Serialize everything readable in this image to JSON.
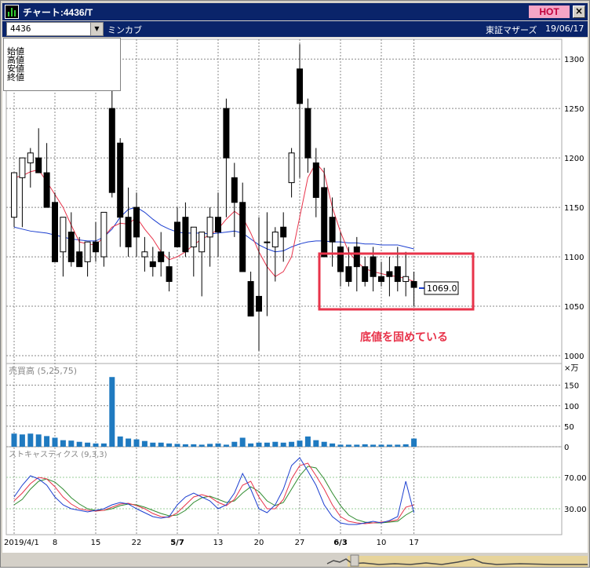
{
  "window": {
    "title": "チャート:4436/T",
    "hot_label": "HOT",
    "close_label": "×"
  },
  "toolbar": {
    "code": "4436",
    "company": "ミンカブ",
    "market": "東証マザーズ",
    "date": "19/06/17"
  },
  "ohlc_labels": [
    "始値",
    "高値",
    "安値",
    "終値"
  ],
  "price_axis": {
    "ticks": [
      "1300",
      "1250",
      "1200",
      "1150",
      "1100",
      "1050",
      "1000"
    ],
    "last_price": "1069.0"
  },
  "volume_panel": {
    "label": "売買高 (5,25,75)",
    "unit": "×万",
    "ticks": [
      "150",
      "100",
      "50",
      "0"
    ]
  },
  "stochastics_panel": {
    "label": "ストキャスティクス (9,3,3)",
    "ticks": [
      "70.00",
      "30.00"
    ]
  },
  "x_axis": {
    "labels": [
      "2019/4/1",
      "8",
      "15",
      "22",
      "5/7",
      "13",
      "20",
      "27",
      "6/3",
      "10",
      "17"
    ],
    "bold_labels": [
      "5/7",
      "6/3"
    ]
  },
  "annotation": {
    "text": "底値を固めている",
    "color": "#e8334a"
  },
  "colors": {
    "ma_short": "#e8334a",
    "ma_long": "#1c3fd0",
    "volume": "#1f7ac0",
    "stoch_k": "#1c3fd0",
    "stoch_d": "#e8334a",
    "stoch_slow": "#2e8b2e"
  },
  "chart_data": {
    "type": "candlestick",
    "dates": [
      "4/1",
      "4/2",
      "4/3",
      "4/4",
      "4/5",
      "4/8",
      "4/9",
      "4/10",
      "4/11",
      "4/12",
      "4/15",
      "4/16",
      "4/17",
      "4/18",
      "4/19",
      "4/22",
      "4/23",
      "4/24",
      "4/25",
      "4/26",
      "5/7",
      "5/8",
      "5/9",
      "5/10",
      "5/13",
      "5/14",
      "5/15",
      "5/16",
      "5/17",
      "5/20",
      "5/21",
      "5/22",
      "5/23",
      "5/24",
      "5/27",
      "5/28",
      "5/29",
      "5/30",
      "5/31",
      "6/3",
      "6/4",
      "6/5",
      "6/6",
      "6/7",
      "6/10",
      "6/11",
      "6/12",
      "6/13",
      "6/14",
      "6/17"
    ],
    "open": [
      1140,
      1180,
      1195,
      1200,
      1185,
      1155,
      1105,
      1125,
      1105,
      1095,
      1115,
      1100,
      1250,
      1215,
      1140,
      1150,
      1100,
      1095,
      1105,
      1090,
      1135,
      1140,
      1110,
      1105,
      1120,
      1140,
      1250,
      1180,
      1155,
      1075,
      1060,
      1115,
      1110,
      1130,
      1175,
      1290,
      1250,
      1195,
      1170,
      1140,
      1110,
      1090,
      1110,
      1090,
      1100,
      1080,
      1085,
      1090,
      1075,
      1075
    ],
    "high": [
      1160,
      1190,
      1210,
      1230,
      1215,
      1165,
      1140,
      1145,
      1120,
      1115,
      1135,
      1130,
      1325,
      1220,
      1170,
      1165,
      1120,
      1110,
      1125,
      1105,
      1150,
      1155,
      1130,
      1125,
      1150,
      1165,
      1260,
      1195,
      1175,
      1085,
      1140,
      1145,
      1130,
      1145,
      1210,
      1315,
      1260,
      1210,
      1190,
      1160,
      1125,
      1110,
      1120,
      1100,
      1110,
      1095,
      1100,
      1110,
      1105,
      1085
    ],
    "low": [
      1130,
      1130,
      1170,
      1185,
      1150,
      1095,
      1080,
      1090,
      1090,
      1080,
      1095,
      1090,
      1160,
      1110,
      1100,
      1100,
      1085,
      1080,
      1080,
      1065,
      1115,
      1100,
      1080,
      1060,
      1090,
      1100,
      1140,
      1120,
      1085,
      1040,
      1005,
      1040,
      1075,
      1095,
      1160,
      1180,
      1185,
      1140,
      1135,
      1090,
      1070,
      1070,
      1065,
      1070,
      1065,
      1070,
      1060,
      1065,
      1060,
      1050
    ],
    "close": [
      1185,
      1200,
      1205,
      1185,
      1150,
      1095,
      1140,
      1095,
      1090,
      1115,
      1105,
      1145,
      1165,
      1140,
      1110,
      1120,
      1105,
      1090,
      1095,
      1075,
      1110,
      1105,
      1130,
      1125,
      1140,
      1125,
      1200,
      1155,
      1085,
      1040,
      1045,
      1115,
      1125,
      1120,
      1205,
      1255,
      1200,
      1160,
      1100,
      1115,
      1085,
      1075,
      1090,
      1075,
      1080,
      1075,
      1080,
      1075,
      1080,
      1069
    ],
    "volume": [
      32,
      30,
      32,
      30,
      26,
      22,
      16,
      15,
      12,
      10,
      8,
      8,
      170,
      25,
      20,
      18,
      14,
      10,
      10,
      8,
      7,
      6,
      6,
      5,
      7,
      8,
      5,
      12,
      22,
      8,
      10,
      10,
      12,
      10,
      12,
      15,
      25,
      16,
      12,
      8,
      5,
      5,
      5,
      6,
      5,
      5,
      5,
      5,
      6,
      20
    ],
    "ma5": [
      1180,
      1182,
      1186,
      1188,
      1176,
      1163,
      1150,
      1132,
      1115,
      1113,
      1112,
      1120,
      1130,
      1134,
      1133,
      1140,
      1128,
      1118,
      1105,
      1097,
      1100,
      1105,
      1112,
      1118,
      1122,
      1128,
      1138,
      1146,
      1140,
      1124,
      1105,
      1090,
      1080,
      1085,
      1100,
      1140,
      1180,
      1195,
      1185,
      1150,
      1125,
      1105,
      1095,
      1088,
      1085,
      1083,
      1081,
      1080,
      1078,
      1075
    ],
    "ma25": [
      1130,
      1128,
      1126,
      1125,
      1124,
      1122,
      1120,
      1118,
      1117,
      1116,
      1116,
      1120,
      1128,
      1140,
      1148,
      1150,
      1145,
      1138,
      1132,
      1128,
      1125,
      1124,
      1124,
      1124,
      1123,
      1124,
      1125,
      1126,
      1124,
      1118,
      1112,
      1108,
      1105,
      1106,
      1110,
      1113,
      1115,
      1116,
      1116,
      1115,
      1115,
      1114,
      1114,
      1113,
      1113,
      1112,
      1112,
      1112,
      1110,
      1108
    ],
    "stoch_k": [
      45,
      60,
      72,
      68,
      60,
      45,
      35,
      30,
      28,
      26,
      28,
      30,
      35,
      38,
      36,
      30,
      25,
      20,
      18,
      20,
      35,
      45,
      50,
      45,
      40,
      30,
      35,
      50,
      75,
      55,
      30,
      25,
      35,
      55,
      85,
      95,
      78,
      60,
      35,
      20,
      12,
      10,
      10,
      12,
      14,
      12,
      15,
      20,
      65,
      25
    ],
    "stoch_d": [
      40,
      50,
      62,
      70,
      68,
      58,
      45,
      36,
      30,
      28,
      27,
      28,
      32,
      36,
      37,
      34,
      30,
      24,
      20,
      19,
      25,
      35,
      45,
      48,
      45,
      38,
      34,
      42,
      60,
      65,
      45,
      30,
      30,
      42,
      68,
      85,
      88,
      72,
      55,
      35,
      20,
      14,
      12,
      11,
      12,
      13,
      14,
      16,
      32,
      35
    ],
    "stoch_slow": [
      35,
      42,
      55,
      65,
      68,
      64,
      55,
      44,
      36,
      30,
      28,
      28,
      30,
      34,
      36,
      35,
      32,
      28,
      24,
      21,
      22,
      28,
      38,
      44,
      46,
      42,
      38,
      40,
      50,
      58,
      52,
      40,
      34,
      38,
      55,
      72,
      84,
      82,
      68,
      50,
      34,
      22,
      16,
      13,
      12,
      12,
      13,
      14,
      22,
      28
    ],
    "ylim": [
      1000,
      1320
    ],
    "volume_ylim": [
      0,
      180
    ],
    "stoch_ylim": [
      0,
      100
    ]
  }
}
